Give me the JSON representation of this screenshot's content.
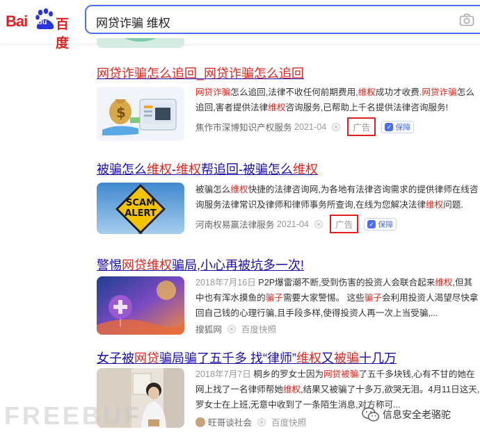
{
  "brand": {
    "logo_latin": "Bai",
    "logo_paw": "du",
    "logo_cn": "百度"
  },
  "search": {
    "query": "网贷诈骗 维权"
  },
  "results": [
    {
      "title_parts": [
        {
          "text": "网贷诈骗怎么追回_网贷诈骗怎么追回",
          "hl": true
        }
      ],
      "desc_parts": [
        {
          "text": "网贷诈骗",
          "hl": true
        },
        {
          "text": "怎么追回,法律不收任何前期费用,",
          "hl": false
        },
        {
          "text": "维权",
          "hl": true
        },
        {
          "text": "成功才收费.",
          "hl": false
        },
        {
          "text": "网贷诈骗",
          "hl": true
        },
        {
          "text": "怎么追回,害者提供法律",
          "hl": false
        },
        {
          "text": "维权",
          "hl": true
        },
        {
          "text": "咨询服务,已帮助上千名提供法律咨询服务!",
          "hl": false
        }
      ],
      "source": "焦作市深博知识产权服务",
      "date": "2021-04",
      "ad_label": "广告",
      "badge": "保障"
    },
    {
      "title_parts": [
        {
          "text": "被骗怎么",
          "hl": false
        },
        {
          "text": "维权",
          "hl": true
        },
        {
          "text": "-",
          "hl": false
        },
        {
          "text": "维权",
          "hl": true
        },
        {
          "text": "帮追回-被骗怎么",
          "hl": false
        },
        {
          "text": "维权",
          "hl": true
        }
      ],
      "thumb_sign": [
        "SCAM",
        "ALERT"
      ],
      "desc_parts": [
        {
          "text": "被骗怎么",
          "hl": false
        },
        {
          "text": "维权",
          "hl": true
        },
        {
          "text": "快捷的法律咨询网,为各地有法律咨询需求的提供律师在线咨询服务法律常识及律师和律师事务所查询,在线为您解决法律",
          "hl": false
        },
        {
          "text": "维权",
          "hl": true
        },
        {
          "text": "问题.",
          "hl": false
        }
      ],
      "source": "河南权易赢法律服务",
      "date": "2021-04",
      "ad_label": "广告",
      "badge": "保障"
    },
    {
      "title_parts": [
        {
          "text": "警惕",
          "hl": false
        },
        {
          "text": "网贷维权",
          "hl": true
        },
        {
          "text": "骗局,小心再被坑多一次!",
          "hl": false
        }
      ],
      "desc_date": "2018年7月16日",
      "desc_parts": [
        {
          "text": " P2P爆雷潮不断,受到伤害的投资人会联合起来",
          "hl": false
        },
        {
          "text": "维权",
          "hl": true
        },
        {
          "text": ",但其中也有浑水摸鱼的",
          "hl": false
        },
        {
          "text": "骗子",
          "hl": true
        },
        {
          "text": "需要大家警惕。 这些",
          "hl": false
        },
        {
          "text": "骗子",
          "hl": true
        },
        {
          "text": "会利用投资人渴望尽快拿回自己钱的心理行骗,且手段多样,使得投资人再一次上当受骗,...",
          "hl": false
        }
      ],
      "source": "搜狐网",
      "snapshot": "百度快照"
    },
    {
      "title_parts": [
        {
          "text": "女子被",
          "hl": false
        },
        {
          "text": "网贷",
          "hl": true
        },
        {
          "text": "骗局骗了五千多 找“律师”",
          "hl": false
        },
        {
          "text": "维权",
          "hl": true
        },
        {
          "text": "又",
          "hl": false
        },
        {
          "text": "被骗",
          "hl": true
        },
        {
          "text": "十几万",
          "hl": false
        }
      ],
      "desc_date": "2018年7月7日",
      "desc_parts": [
        {
          "text": " 桐乡的罗女士因为",
          "hl": false
        },
        {
          "text": "网贷被骗",
          "hl": true
        },
        {
          "text": "了五千多块钱,心有不甘的她在网上找了一名律师帮她",
          "hl": false
        },
        {
          "text": "维权",
          "hl": true
        },
        {
          "text": ",结果又被骗了十多万,欲哭无泪。4月11日这天,罗女士在上班,无意中收到了一条陌生消息,对方称可...",
          "hl": false
        }
      ],
      "source": "旺哥谈社会",
      "snapshot": "百度快照"
    }
  ],
  "footer": {
    "watermark": "FREEBUF",
    "wechat_account": "信息安全老骆驼"
  },
  "colors": {
    "accent": "#4e6ef2",
    "highlight": "#e0251e",
    "link": "#1a0dab",
    "ad_frame": "#e02020"
  }
}
